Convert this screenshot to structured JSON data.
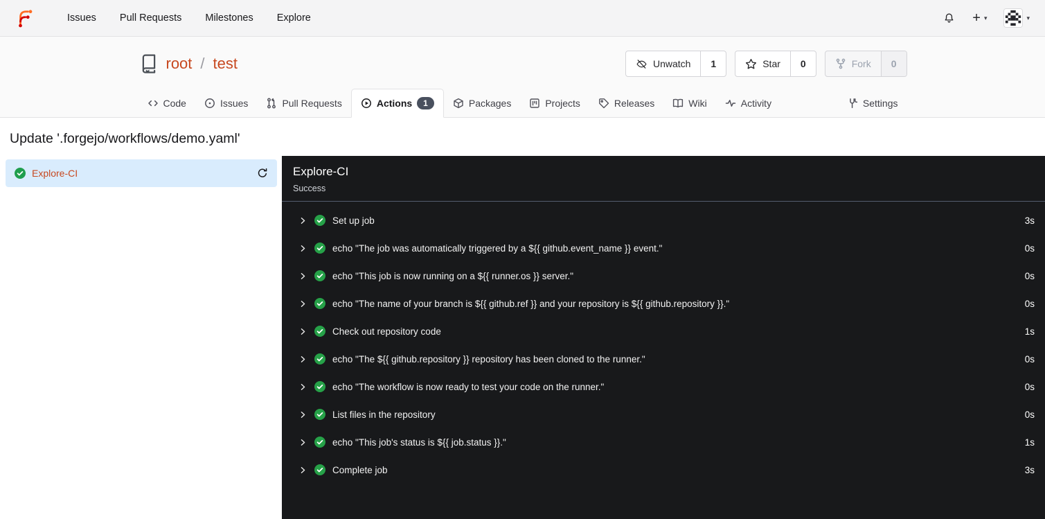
{
  "navbar": {
    "items": [
      {
        "label": "Issues"
      },
      {
        "label": "Pull Requests"
      },
      {
        "label": "Milestones"
      },
      {
        "label": "Explore"
      }
    ],
    "create_label": "+"
  },
  "repo": {
    "owner": "root",
    "separator": "/",
    "name": "test",
    "buttons": {
      "unwatch": {
        "label": "Unwatch",
        "count": "1",
        "icon": "eye-slash-icon"
      },
      "star": {
        "label": "Star",
        "count": "0",
        "icon": "star-icon"
      },
      "fork": {
        "label": "Fork",
        "count": "0",
        "icon": "fork-icon",
        "disabled": true
      }
    }
  },
  "tabs": [
    {
      "label": "Code",
      "icon": "code-icon"
    },
    {
      "label": "Issues",
      "icon": "issue-icon"
    },
    {
      "label": "Pull Requests",
      "icon": "pull-request-icon"
    },
    {
      "label": "Actions",
      "icon": "play-circle-icon",
      "badge": "1",
      "active": true
    },
    {
      "label": "Packages",
      "icon": "package-icon"
    },
    {
      "label": "Projects",
      "icon": "project-icon"
    },
    {
      "label": "Releases",
      "icon": "tag-icon"
    },
    {
      "label": "Wiki",
      "icon": "book-icon"
    },
    {
      "label": "Activity",
      "icon": "pulse-icon"
    },
    {
      "label": "Settings",
      "icon": "tools-icon"
    }
  ],
  "page": {
    "title": "Update '.forgejo/workflows/demo.yaml'"
  },
  "sidebar": {
    "job": {
      "name": "Explore-CI",
      "status": "success"
    }
  },
  "panel": {
    "title": "Explore-CI",
    "status": "Success",
    "steps": [
      {
        "name": "Set up job",
        "duration": "3s",
        "status": "success"
      },
      {
        "name": "echo \"The job was automatically triggered by a ${{ github.event_name }} event.\"",
        "duration": "0s",
        "status": "success"
      },
      {
        "name": "echo \"This job is now running on a ${{ runner.os }} server.\"",
        "duration": "0s",
        "status": "success"
      },
      {
        "name": "echo \"The name of your branch is ${{ github.ref }} and your repository is ${{ github.repository }}.\"",
        "duration": "0s",
        "status": "success"
      },
      {
        "name": "Check out repository code",
        "duration": "1s",
        "status": "success"
      },
      {
        "name": "echo \"The ${{ github.repository }} repository has been cloned to the runner.\"",
        "duration": "0s",
        "status": "success"
      },
      {
        "name": "echo \"The workflow is now ready to test your code on the runner.\"",
        "duration": "0s",
        "status": "success"
      },
      {
        "name": "List files in the repository",
        "duration": "0s",
        "status": "success"
      },
      {
        "name": "echo \"This job's status is ${{ job.status }}.\"",
        "duration": "1s",
        "status": "success"
      },
      {
        "name": "Complete job",
        "duration": "3s",
        "status": "success"
      }
    ]
  },
  "colors": {
    "primary_link": "#c7481f",
    "success_green": "#26a148",
    "selected_row_bg": "#d9ecfd",
    "panel_bg": "#18191b",
    "badge_bg": "#49505e",
    "navbar_bg": "#f4f4f5"
  }
}
